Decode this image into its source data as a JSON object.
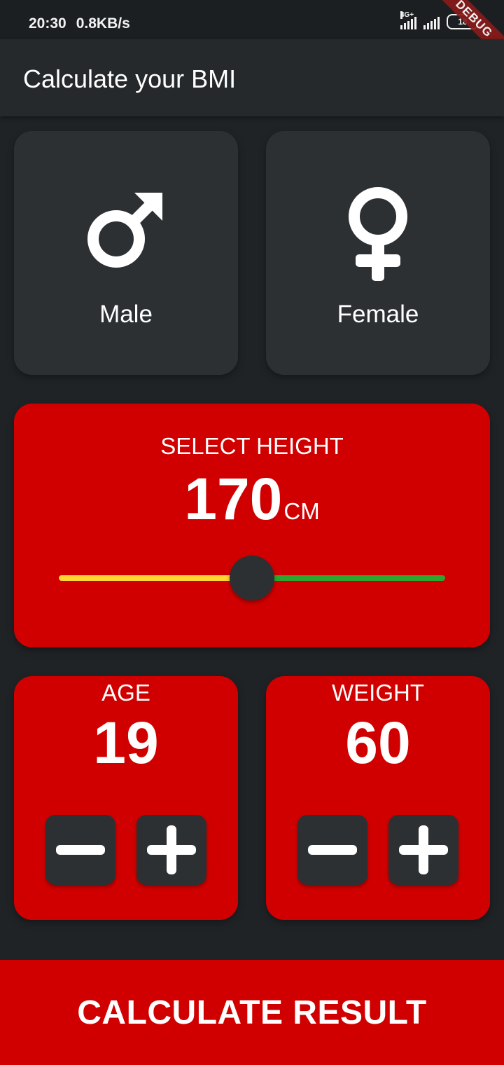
{
  "status_bar": {
    "time": "20:30",
    "network_speed": "0.8KB/s",
    "network_type": "4G+",
    "battery": "18",
    "debug_banner": "DEBUG"
  },
  "app_bar": {
    "title": "Calculate your BMI"
  },
  "gender": {
    "male": {
      "label": "Male",
      "icon": "male-symbol-icon"
    },
    "female": {
      "label": "Female",
      "icon": "female-symbol-icon"
    }
  },
  "height": {
    "title": "SELECT HEIGHT",
    "value": "170",
    "unit": "CM",
    "slider_fraction": 0.5,
    "active_color": "#ffd633",
    "inactive_color": "#2ea52e"
  },
  "age": {
    "title": "AGE",
    "value": "19",
    "decrement_icon": "minus-icon",
    "increment_icon": "plus-icon"
  },
  "weight": {
    "title": "WEIGHT",
    "value": "60",
    "decrement_icon": "minus-icon",
    "increment_icon": "plus-icon"
  },
  "calculate": {
    "label": "CALCULATE RESULT"
  },
  "colors": {
    "background": "#202326",
    "card_inactive": "#2c3032",
    "card_active": "#d10000",
    "accent": "#d10000"
  }
}
